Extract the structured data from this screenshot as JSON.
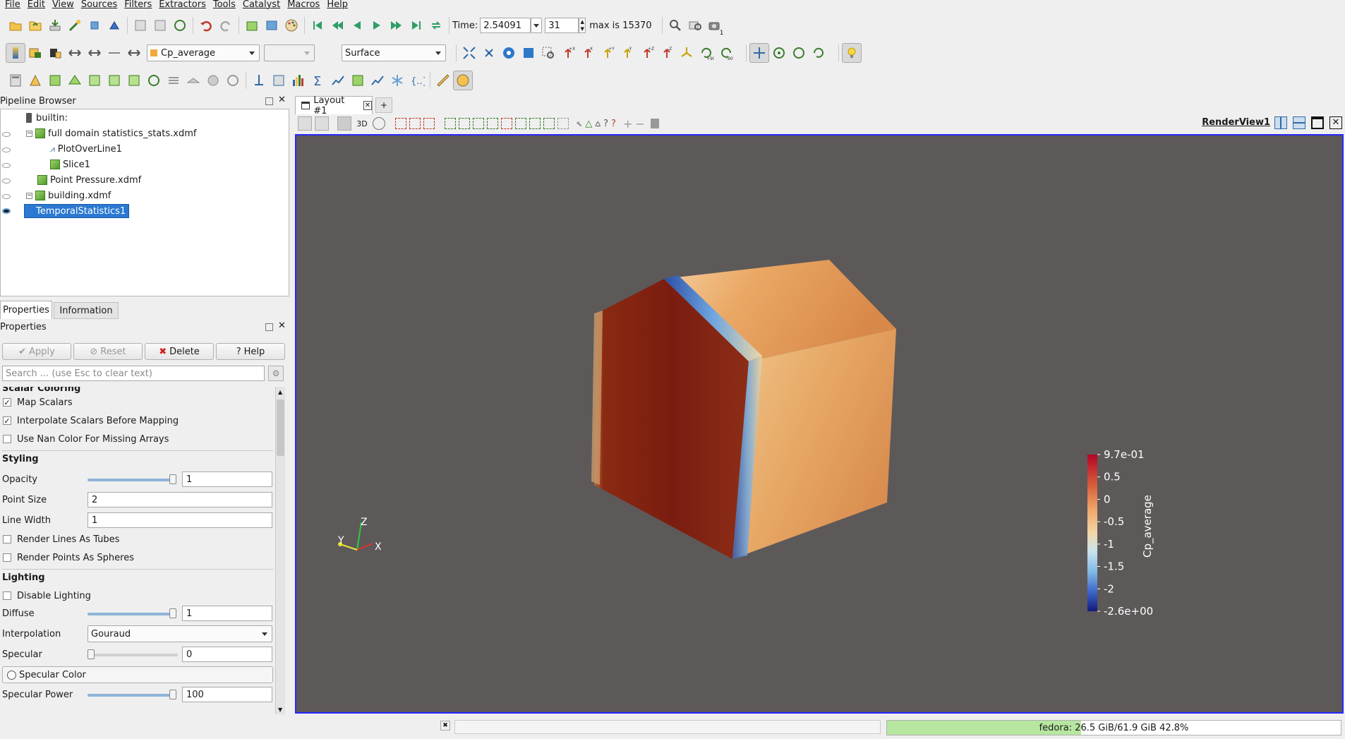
{
  "menu": [
    "File",
    "Edit",
    "View",
    "Sources",
    "Filters",
    "Extractors",
    "Tools",
    "Catalyst",
    "Macros",
    "Help"
  ],
  "time": {
    "label": "Time:",
    "value": "2.54091",
    "step": "31",
    "max_label": "max is 15370",
    "camera_count": "1"
  },
  "color_by": {
    "array": "Cp_average",
    "component": "",
    "representation": "Surface"
  },
  "pipeline": {
    "title": "Pipeline Browser",
    "items": [
      {
        "label": "builtin:",
        "level": 0
      },
      {
        "label": "full domain statistics_stats.xdmf",
        "level": 1
      },
      {
        "label": "PlotOverLine1",
        "level": 2
      },
      {
        "label": "Slice1",
        "level": 2
      },
      {
        "label": "Point Pressure.xdmf",
        "level": 1
      },
      {
        "label": "building.xdmf",
        "level": 1
      },
      {
        "label": "TemporalStatistics1",
        "level": 1,
        "selected": true
      }
    ]
  },
  "tabs": {
    "properties": "Properties",
    "information": "Information"
  },
  "properties": {
    "title": "Properties",
    "apply": "Apply",
    "reset": "Reset",
    "delete": "Delete",
    "help": "Help",
    "search_placeholder": "Search ... (use Esc to clear text)",
    "scalar_coloring": "Scalar Coloring",
    "map_scalars": "Map Scalars",
    "interpolate": "Interpolate Scalars Before Mapping",
    "nan_color": "Use Nan Color For Missing Arrays",
    "styling": "Styling",
    "opacity_label": "Opacity",
    "opacity": "1",
    "point_size_label": "Point Size",
    "point_size": "2",
    "line_width_label": "Line Width",
    "line_width": "1",
    "tubes": "Render Lines As Tubes",
    "spheres": "Render Points As Spheres",
    "lighting": "Lighting",
    "disable_lighting": "Disable Lighting",
    "diffuse_label": "Diffuse",
    "diffuse": "1",
    "interpolation_label": "Interpolation",
    "interpolation": "Gouraud",
    "specular_label": "Specular",
    "specular": "0",
    "specular_color": "Specular Color",
    "specular_power_label": "Specular Power",
    "specular_power": "100"
  },
  "layout": {
    "tab": "Layout #1",
    "add": "+",
    "view_name": "RenderView1",
    "mode_3d": "3D"
  },
  "axes": {
    "x": "X",
    "y": "Y",
    "z": "Z"
  },
  "legend": {
    "title": "Cp_average",
    "ticks": [
      "9.7e-01",
      "0.5",
      "0",
      "-0.5",
      "-1",
      "-1.5",
      "-2",
      "-2.6e+00"
    ]
  },
  "status": {
    "memory": "fedora: 26.5 GiB/61.9 GiB 42.8%",
    "memory_fraction": 0.428
  }
}
